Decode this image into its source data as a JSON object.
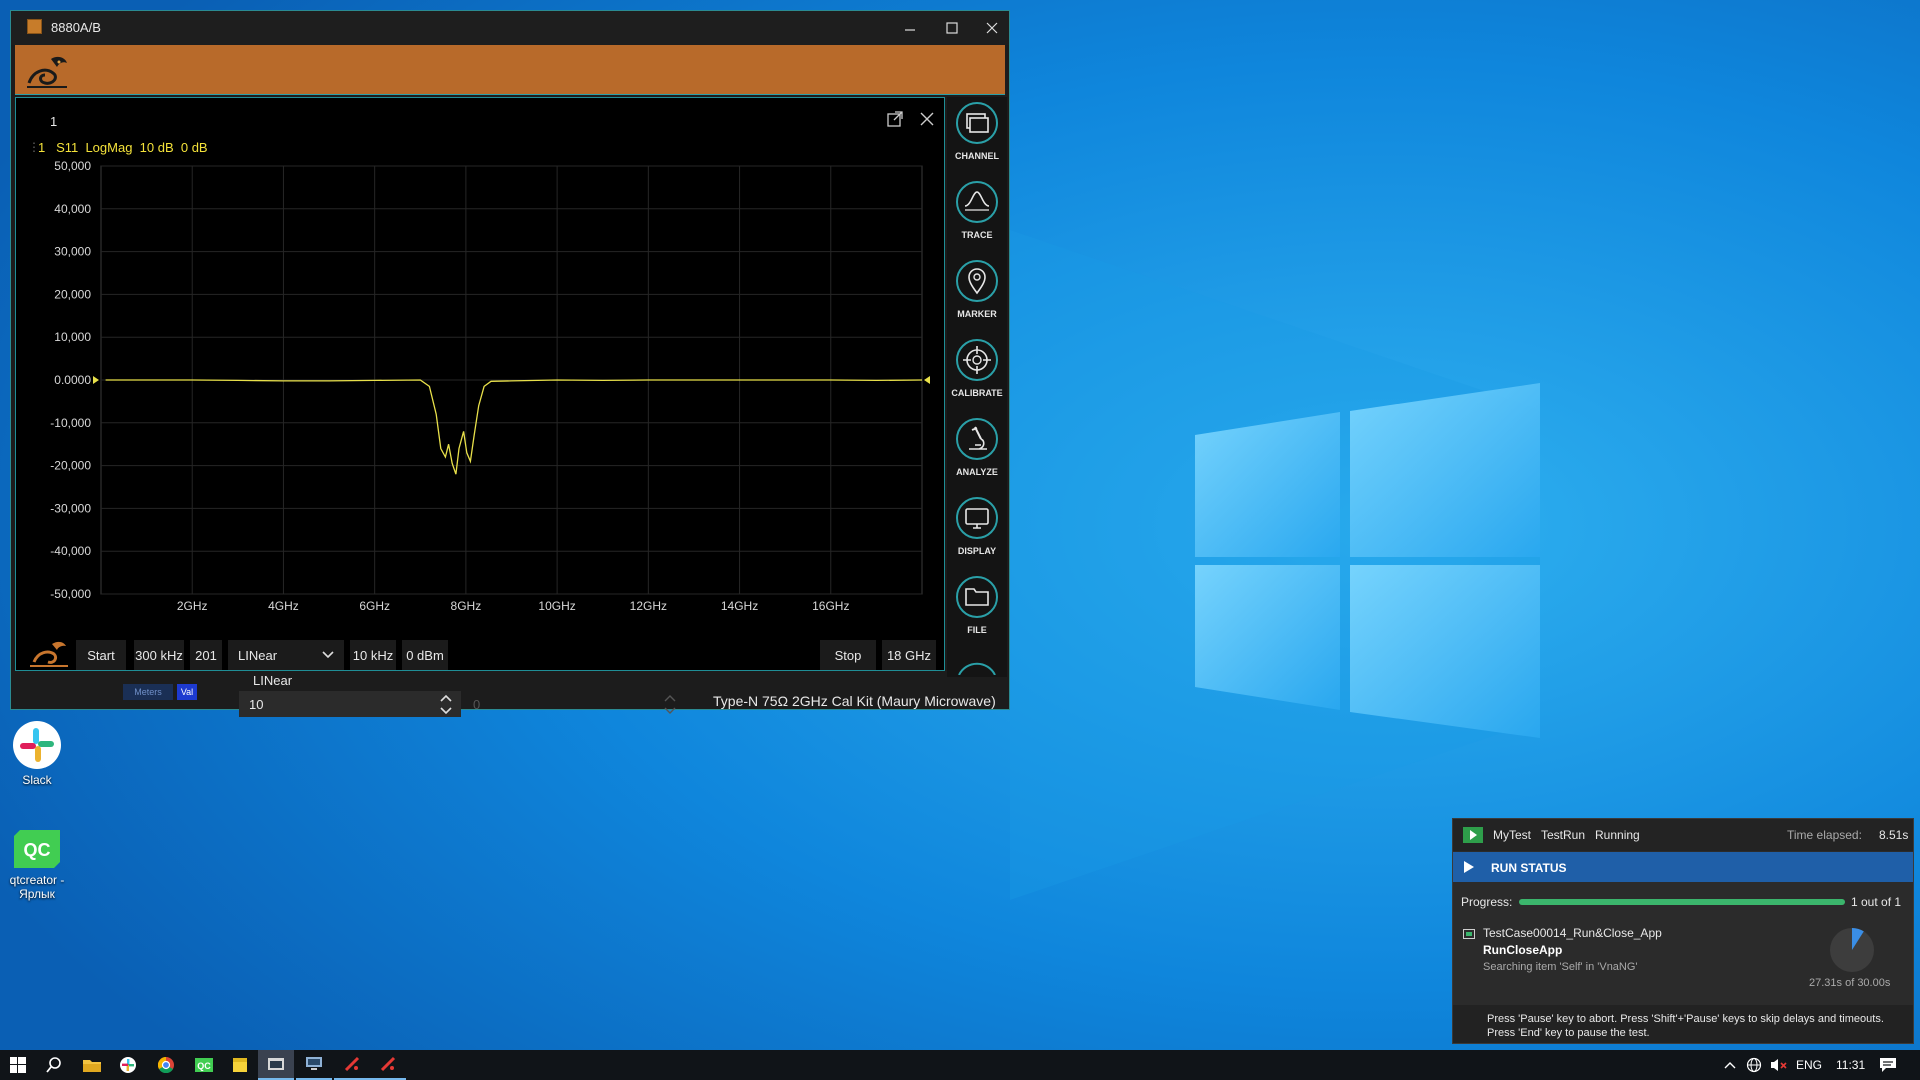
{
  "window": {
    "title": "8880A/B"
  },
  "panel": {
    "number": "1",
    "trace_label": "1   S11  LogMag  10 dB  0 dB"
  },
  "chart_data": {
    "type": "line",
    "series": [
      {
        "color": "#e8e04a",
        "points": [
          [
            0.1,
            0.0
          ],
          [
            2,
            0.0
          ],
          [
            3,
            -0.1
          ],
          [
            4,
            -0.2
          ],
          [
            5,
            -0.2
          ],
          [
            6,
            -0.1
          ],
          [
            7,
            0.0
          ],
          [
            7.2,
            -1.5
          ],
          [
            7.35,
            -8
          ],
          [
            7.45,
            -16
          ],
          [
            7.55,
            -18
          ],
          [
            7.62,
            -15
          ],
          [
            7.7,
            -19.5
          ],
          [
            7.78,
            -22
          ],
          [
            7.85,
            -16
          ],
          [
            7.95,
            -12
          ],
          [
            8.02,
            -17
          ],
          [
            8.1,
            -19
          ],
          [
            8.18,
            -13
          ],
          [
            8.28,
            -6
          ],
          [
            8.4,
            -1.5
          ],
          [
            8.55,
            -0.3
          ],
          [
            9,
            -0.2
          ],
          [
            10,
            0.0
          ],
          [
            11,
            -0.1
          ],
          [
            12,
            0.0
          ],
          [
            13,
            0.0
          ],
          [
            14,
            0.0
          ],
          [
            15,
            0.0
          ],
          [
            16,
            0.0
          ],
          [
            17,
            -0.1
          ],
          [
            18,
            0.0
          ]
        ]
      }
    ],
    "y_ticks": [
      "50,000",
      "40,000",
      "30,000",
      "20,000",
      "10,000",
      "0.0000",
      "-10,000",
      "-20,000",
      "-30,000",
      "-40,000",
      "-50,000"
    ],
    "x_ticks": [
      "2GHz",
      "4GHz",
      "6GHz",
      "8GHz",
      "10GHz",
      "12GHz",
      "14GHz",
      "16GHz"
    ],
    "x_tick_values": [
      2,
      4,
      6,
      8,
      10,
      12,
      14,
      16
    ],
    "xlim": [
      0,
      18
    ],
    "ylim": [
      -50,
      50
    ],
    "grid": true,
    "reference_level": "0.0000"
  },
  "controls": {
    "start_label": "Start",
    "start_freq": "300 kHz",
    "points": "201",
    "sweep_type": "LINear",
    "ifbw": "10 kHz",
    "power": "0 dBm",
    "stop_label": "Stop",
    "stop_freq": "18 GHz"
  },
  "sidebar": {
    "items": [
      "CHANNEL",
      "TRACE",
      "MARKER",
      "CALIBRATE",
      "ANALYZE",
      "DISPLAY",
      "FILE"
    ]
  },
  "strip": {
    "meters_tab": "Meters",
    "val_tab": "Val",
    "field_label": "LINear",
    "field_value": "10",
    "second_value": "0",
    "cal_kit": "Type-N 75Ω 2GHz Cal Kit (Maury Microwave)"
  },
  "desktop": {
    "icons": [
      {
        "name": "Slack"
      },
      {
        "name": "qtcreator - Ярлык"
      }
    ]
  },
  "run_status": {
    "test_name": "MyTest",
    "run_name": "TestRun",
    "state": "Running",
    "time_label": "Time elapsed:",
    "time_value": "8.51s",
    "section_title": "RUN STATUS",
    "progress_label": "Progress:",
    "progress_fraction": 1.0,
    "progress_text": "1 out of 1",
    "testcase": "TestCase00014_Run&Close_App",
    "step": "RunCloseApp",
    "activity": "Searching item 'Self' in 'VnaNG'",
    "timeout_text": "27.31s of 30.00s",
    "timeout_fraction": 0.09,
    "footer_line1": "Press 'Pause' key to abort. Press 'Shift'+'Pause' keys to skip delays and timeouts.",
    "footer_line2": "Press 'End' key to pause the test."
  },
  "tray": {
    "language": "ENG",
    "clock": "11:31"
  },
  "colors": {
    "accent_teal": "#2aa0a8",
    "banner_orange": "#b86a2a",
    "trace_yellow": "#e8e04a",
    "status_blue": "#1f5fa8",
    "progress_green": "#3bb56c"
  }
}
